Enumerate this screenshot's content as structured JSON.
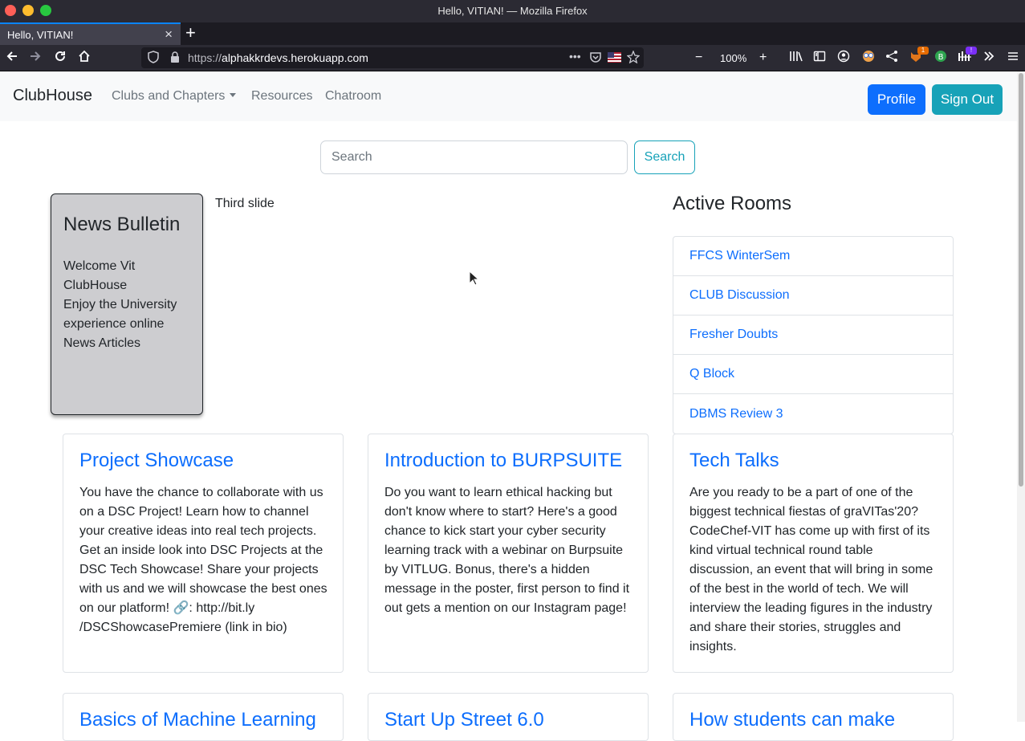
{
  "window": {
    "title": "Hello, VITIAN! — Mozilla Firefox"
  },
  "tab": {
    "title": "Hello, VITIAN!"
  },
  "urlbar": {
    "scheme": "https://",
    "host": "alphakkrdevs.herokuapp.com"
  },
  "zoom": "100%",
  "toolbar_badges": {
    "extension1": "1",
    "extension2": "!"
  },
  "site": {
    "brand": "ClubHouse",
    "nav": {
      "clubs": "Clubs and Chapters",
      "resources": "Resources",
      "chatroom": "Chatroom"
    },
    "profile_label": "Profile",
    "signout_label": "Sign Out"
  },
  "search": {
    "placeholder": "Search",
    "button": "Search"
  },
  "bulletin": {
    "title": "News Bulletin",
    "lines": [
      "Welcome Vit ClubHouse",
      "Enjoy the University experience online",
      "News Articles"
    ]
  },
  "carousel": {
    "caption": "Third slide"
  },
  "rooms": {
    "title": "Active Rooms",
    "items": [
      "FFCS WinterSem",
      "CLUB Discussion",
      "Fresher Doubts",
      "Q Block",
      "DBMS Review 3"
    ]
  },
  "cards": [
    {
      "title": "Project Showcase",
      "text": "You have the chance to collaborate with us on a DSC Project! Learn how to channel your creative ideas into real tech projects. Get an inside look into DSC Projects at the DSC Tech Showcase! Share your projects with us and we will showcase the best ones on our platform! 🔗: http://bit.ly /DSCShowcasePremiere (link in bio)"
    },
    {
      "title": "Introduction to BURPSUITE",
      "text": "Do you want to learn ethical hacking but don't know where to start? Here's a good chance to kick start your cyber security learning track with a webinar on Burpsuite by VITLUG. Bonus, there's a hidden message in the poster, first person to find it out gets a mention on our Instagram page!"
    },
    {
      "title": "Tech Talks",
      "text": "Are you ready to be a part of one of the biggest technical fiestas of graVITas'20? CodeChef-VIT has come up with first of its kind virtual technical round table discussion, an event that will bring in some of the best in the world of tech. We will interview the leading figures in the industry and share their stories, struggles and insights."
    },
    {
      "title": "Basics of Machine Learning",
      "text": ""
    },
    {
      "title": "Start Up Street 6.0",
      "text": ""
    },
    {
      "title": "How students can make",
      "text": ""
    }
  ]
}
